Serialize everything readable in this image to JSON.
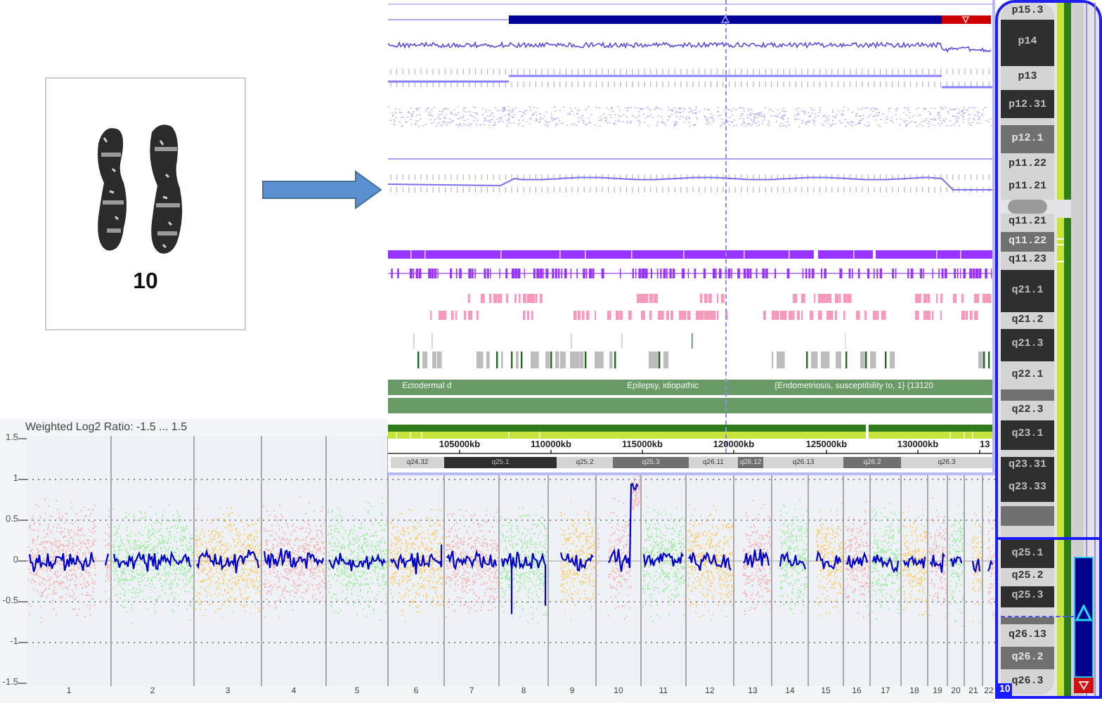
{
  "karyotype_card": {
    "label": "10"
  },
  "browser": {
    "disease_labels": [
      "Ectodermal d",
      "Epilepsy, idiopathic",
      "{Endometriosis, susceptibility to, 1} (13120"
    ],
    "scale_labels": [
      "105000kb",
      "110000kb",
      "115000kb",
      "120000kb",
      "125000kb",
      "130000kb",
      "13"
    ],
    "bands": [
      {
        "label": "q24.32",
        "kind": "light"
      },
      {
        "label": "q25.1",
        "kind": "dark"
      },
      {
        "label": "q25.2",
        "kind": "light"
      },
      {
        "label": "q25.3",
        "kind": "gray"
      },
      {
        "label": "q26.11",
        "kind": "light"
      },
      {
        "label": "q26.12",
        "kind": "gray"
      },
      {
        "label": "q26.13",
        "kind": "light"
      },
      {
        "label": "q26.2",
        "kind": "gray"
      },
      {
        "label": "q26.3",
        "kind": "light"
      }
    ]
  },
  "ideogram": {
    "chromosome": "10",
    "bands": [
      {
        "label": "p15.3",
        "kind": "light"
      },
      {
        "label": "p14",
        "kind": "dark"
      },
      {
        "label": "p13",
        "kind": "light"
      },
      {
        "kind": "dark"
      },
      {
        "label": "p12.31",
        "kind": "dark"
      },
      {
        "kind": "light"
      },
      {
        "label": "p12.1",
        "kind": "gray"
      },
      {
        "label": "p11.22",
        "kind": "light"
      },
      {
        "label": "p11.21",
        "kind": "light"
      },
      {
        "kind": "acen"
      },
      {
        "label": "q11.21",
        "kind": "light"
      },
      {
        "label": "q11.22",
        "kind": "gray"
      },
      {
        "label": "q11.23",
        "kind": "light"
      },
      {
        "label": "q21.1",
        "kind": "dark"
      },
      {
        "label": "q21.2",
        "kind": "light"
      },
      {
        "label": "q21.3",
        "kind": "dark"
      },
      {
        "label": "q22.1",
        "kind": "light"
      },
      {
        "kind": "gray"
      },
      {
        "label": "q22.3",
        "kind": "light"
      },
      {
        "label": "q23.1",
        "kind": "dark"
      },
      {
        "kind": "light"
      },
      {
        "label": "q23.31",
        "kind": "dark"
      },
      {
        "label": "q23.33",
        "kind": "dark"
      },
      {
        "kind": "light"
      },
      {
        "kind": "gray"
      },
      {
        "kind": "light"
      },
      {
        "label": "q25.1",
        "kind": "dark"
      },
      {
        "label": "q25.2",
        "kind": "light"
      },
      {
        "label": "q25.3",
        "kind": "dark"
      },
      {
        "kind": "light"
      },
      {
        "kind": "gray"
      },
      {
        "label": "q26.13",
        "kind": "light"
      },
      {
        "label": "q26.2",
        "kind": "gray"
      },
      {
        "label": "q26.3",
        "kind": "light"
      }
    ]
  },
  "plot": {
    "title": "Weighted Log2 Ratio: -1.5 ... 1.5",
    "y_ticks": [
      "1.5",
      "1",
      "0.5",
      "0",
      "-0.5",
      "-1",
      "-1.5"
    ],
    "chromosomes": [
      "1",
      "2",
      "3",
      "4",
      "5",
      "6",
      "7",
      "8",
      "9",
      "10",
      "11",
      "12",
      "13",
      "14",
      "15",
      "16",
      "17",
      "18",
      "19",
      "20",
      "21",
      "22"
    ]
  }
}
